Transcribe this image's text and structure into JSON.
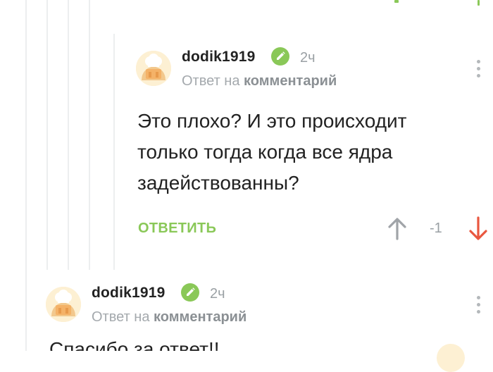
{
  "comment1": {
    "author": "dodik1919",
    "time": "2ч",
    "reply_prefix": "Ответ на",
    "reply_target": "комментарий",
    "body": "Это плохо? И это происходит только тогда когда все ядра задействованны?",
    "reply_label": "ОТВЕТИТЬ",
    "rating": "-1"
  },
  "comment2": {
    "author": "dodik1919",
    "time": "2ч",
    "reply_prefix": "Ответ на",
    "reply_target": "комментарий",
    "body_partial": "Спасибо за ответ!!"
  },
  "icons": {
    "verified": "pencil-check-icon",
    "upvote": "arrow-up-icon",
    "downvote": "arrow-down-icon",
    "more": "kebab-menu-icon",
    "avatar": "chef-hat-avatar"
  },
  "colors": {
    "accent_green": "#8ac858",
    "downvote_red": "#e9573f",
    "muted_text": "#9aa0a4",
    "thread_line": "#eceeef"
  }
}
